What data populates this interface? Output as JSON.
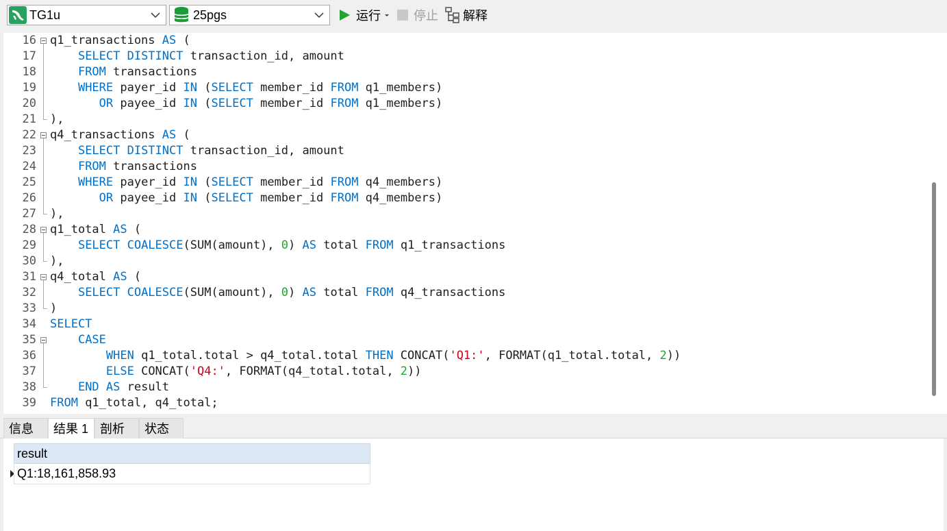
{
  "toolbar": {
    "connection": "TG1u",
    "database": "25pgs",
    "run_label": "运行",
    "stop_label": "停止",
    "explain_label": "解释",
    "colors": {
      "run": "#22a52e",
      "connection": "#2aa15e",
      "database": "#1f9a3a"
    }
  },
  "editor": {
    "lines": [
      {
        "num": "16",
        "tokens": [
          {
            "t": "q1_transactions "
          },
          {
            "t": "AS",
            "c": "kw"
          },
          {
            "t": " ("
          }
        ]
      },
      {
        "num": "17",
        "tokens": [
          {
            "t": "    "
          },
          {
            "t": "SELECT DISTINCT",
            "c": "kw"
          },
          {
            "t": " transaction_id, amount"
          }
        ]
      },
      {
        "num": "18",
        "tokens": [
          {
            "t": "    "
          },
          {
            "t": "FROM",
            "c": "kw"
          },
          {
            "t": " transactions"
          }
        ]
      },
      {
        "num": "19",
        "tokens": [
          {
            "t": "    "
          },
          {
            "t": "WHERE",
            "c": "kw"
          },
          {
            "t": " payer_id "
          },
          {
            "t": "IN",
            "c": "kw"
          },
          {
            "t": " ("
          },
          {
            "t": "SELECT",
            "c": "kw"
          },
          {
            "t": " member_id "
          },
          {
            "t": "FROM",
            "c": "kw"
          },
          {
            "t": " q1_members)"
          }
        ]
      },
      {
        "num": "20",
        "tokens": [
          {
            "t": "       "
          },
          {
            "t": "OR",
            "c": "kw"
          },
          {
            "t": " payee_id "
          },
          {
            "t": "IN",
            "c": "kw"
          },
          {
            "t": " ("
          },
          {
            "t": "SELECT",
            "c": "kw"
          },
          {
            "t": " member_id "
          },
          {
            "t": "FROM",
            "c": "kw"
          },
          {
            "t": " q1_members)"
          }
        ]
      },
      {
        "num": "21",
        "tokens": [
          {
            "t": "),"
          }
        ]
      },
      {
        "num": "22",
        "tokens": [
          {
            "t": "q4_transactions "
          },
          {
            "t": "AS",
            "c": "kw"
          },
          {
            "t": " ("
          }
        ]
      },
      {
        "num": "23",
        "tokens": [
          {
            "t": "    "
          },
          {
            "t": "SELECT DISTINCT",
            "c": "kw"
          },
          {
            "t": " transaction_id, amount"
          }
        ]
      },
      {
        "num": "24",
        "tokens": [
          {
            "t": "    "
          },
          {
            "t": "FROM",
            "c": "kw"
          },
          {
            "t": " transactions"
          }
        ]
      },
      {
        "num": "25",
        "tokens": [
          {
            "t": "    "
          },
          {
            "t": "WHERE",
            "c": "kw"
          },
          {
            "t": " payer_id "
          },
          {
            "t": "IN",
            "c": "kw"
          },
          {
            "t": " ("
          },
          {
            "t": "SELECT",
            "c": "kw"
          },
          {
            "t": " member_id "
          },
          {
            "t": "FROM",
            "c": "kw"
          },
          {
            "t": " q4_members)"
          }
        ]
      },
      {
        "num": "26",
        "tokens": [
          {
            "t": "       "
          },
          {
            "t": "OR",
            "c": "kw"
          },
          {
            "t": " payee_id "
          },
          {
            "t": "IN",
            "c": "kw"
          },
          {
            "t": " ("
          },
          {
            "t": "SELECT",
            "c": "kw"
          },
          {
            "t": " member_id "
          },
          {
            "t": "FROM",
            "c": "kw"
          },
          {
            "t": " q4_members)"
          }
        ]
      },
      {
        "num": "27",
        "tokens": [
          {
            "t": "),"
          }
        ]
      },
      {
        "num": "28",
        "tokens": [
          {
            "t": "q1_total "
          },
          {
            "t": "AS",
            "c": "kw"
          },
          {
            "t": " ("
          }
        ]
      },
      {
        "num": "29",
        "tokens": [
          {
            "t": "    "
          },
          {
            "t": "SELECT COALESCE",
            "c": "kw"
          },
          {
            "t": "(SUM(amount), "
          },
          {
            "t": "0",
            "c": "num"
          },
          {
            "t": ") "
          },
          {
            "t": "AS",
            "c": "kw"
          },
          {
            "t": " total "
          },
          {
            "t": "FROM",
            "c": "kw"
          },
          {
            "t": " q1_transactions"
          }
        ]
      },
      {
        "num": "30",
        "tokens": [
          {
            "t": "),"
          }
        ]
      },
      {
        "num": "31",
        "tokens": [
          {
            "t": "q4_total "
          },
          {
            "t": "AS",
            "c": "kw"
          },
          {
            "t": " ("
          }
        ]
      },
      {
        "num": "32",
        "tokens": [
          {
            "t": "    "
          },
          {
            "t": "SELECT COALESCE",
            "c": "kw"
          },
          {
            "t": "(SUM(amount), "
          },
          {
            "t": "0",
            "c": "num"
          },
          {
            "t": ") "
          },
          {
            "t": "AS",
            "c": "kw"
          },
          {
            "t": " total "
          },
          {
            "t": "FROM",
            "c": "kw"
          },
          {
            "t": " q4_transactions"
          }
        ]
      },
      {
        "num": "33",
        "tokens": [
          {
            "t": ")"
          }
        ]
      },
      {
        "num": "34",
        "tokens": [
          {
            "t": "SELECT",
            "c": "kw"
          }
        ]
      },
      {
        "num": "35",
        "tokens": [
          {
            "t": "    "
          },
          {
            "t": "CASE",
            "c": "kw"
          }
        ]
      },
      {
        "num": "36",
        "tokens": [
          {
            "t": "        "
          },
          {
            "t": "WHEN",
            "c": "kw"
          },
          {
            "t": " q1_total.total > q4_total.total "
          },
          {
            "t": "THEN",
            "c": "kw"
          },
          {
            "t": " CONCAT("
          },
          {
            "t": "'Q1:'",
            "c": "str"
          },
          {
            "t": ", FORMAT(q1_total.total, "
          },
          {
            "t": "2",
            "c": "num"
          },
          {
            "t": "))"
          }
        ]
      },
      {
        "num": "37",
        "tokens": [
          {
            "t": "        "
          },
          {
            "t": "ELSE",
            "c": "kw"
          },
          {
            "t": " CONCAT("
          },
          {
            "t": "'Q4:'",
            "c": "str"
          },
          {
            "t": ", FORMAT(q4_total.total, "
          },
          {
            "t": "2",
            "c": "num"
          },
          {
            "t": "))"
          }
        ]
      },
      {
        "num": "38",
        "tokens": [
          {
            "t": "    "
          },
          {
            "t": "END AS",
            "c": "kw"
          },
          {
            "t": " result"
          }
        ]
      },
      {
        "num": "39",
        "tokens": [
          {
            "t": "FROM",
            "c": "kw"
          },
          {
            "t": " q1_total, q4_total;"
          }
        ]
      }
    ]
  },
  "result_tabs": [
    {
      "label": "信息",
      "active": false
    },
    {
      "label": "结果 1",
      "active": true
    },
    {
      "label": "剖析",
      "active": false
    },
    {
      "label": "状态",
      "active": false
    }
  ],
  "result_grid": {
    "columns": [
      "result"
    ],
    "rows": [
      [
        "Q1:18,161,858.93"
      ]
    ]
  }
}
